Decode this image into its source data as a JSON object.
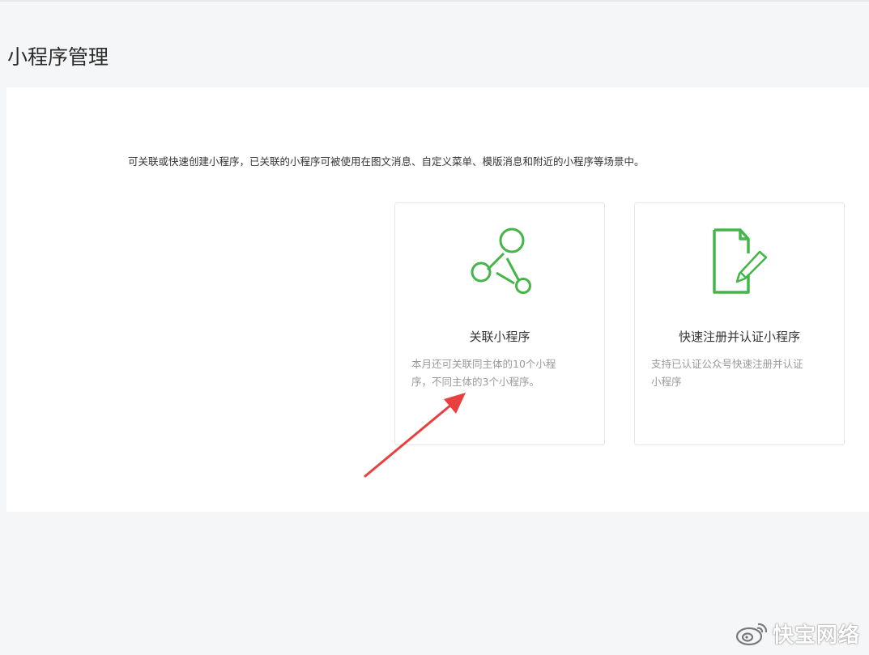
{
  "page": {
    "title": "小程序管理"
  },
  "panel": {
    "description": "可关联或快速创建小程序，已关联的小程序可被使用在图文消息、自定义菜单、模版消息和附近的小程序等场景中。"
  },
  "cards": {
    "link": {
      "title": "关联小程序",
      "desc_line1": "本月还可关联同主体的10个小程",
      "desc_line2": "序，不同主体的3个小程序。",
      "icon": "network-link-icon"
    },
    "register": {
      "title": "快速注册并认证小程序",
      "desc_line1": "支持已认证公众号快速注册并认证",
      "desc_line2": "小程序",
      "icon": "document-edit-icon"
    }
  },
  "annotation": {
    "arrow_color": "#e8403f"
  },
  "watermark": {
    "text": "快宝网络",
    "icon": "weibo-logo-icon"
  },
  "colors": {
    "accent": "#44b549",
    "background": "#f5f6f7",
    "panel": "#ffffff"
  }
}
